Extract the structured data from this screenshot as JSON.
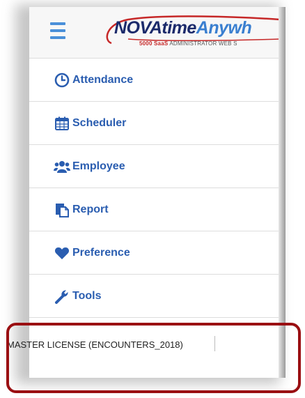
{
  "header": {
    "logo": {
      "brand_dark": "NOVAtime",
      "brand_light": "Anywh",
      "tag_saas": "5000 SaaS",
      "tag_rest": "ADMINISTRATOR WEB S"
    }
  },
  "menu": {
    "items": [
      {
        "label": "Attendance",
        "icon": "clock-icon"
      },
      {
        "label": "Scheduler",
        "icon": "calendar-icon"
      },
      {
        "label": "Employee",
        "icon": "users-icon"
      },
      {
        "label": "Report",
        "icon": "report-icon"
      },
      {
        "label": "Preference",
        "icon": "heart-icon"
      },
      {
        "label": "Tools",
        "icon": "wrench-icon"
      }
    ]
  },
  "license": {
    "text": "MASTER LICENSE (ENCOUNTERS_2018)"
  },
  "colors": {
    "accent": "#2a5db0",
    "hamburger": "#4a90d9",
    "highlight": "#9a0f12"
  }
}
